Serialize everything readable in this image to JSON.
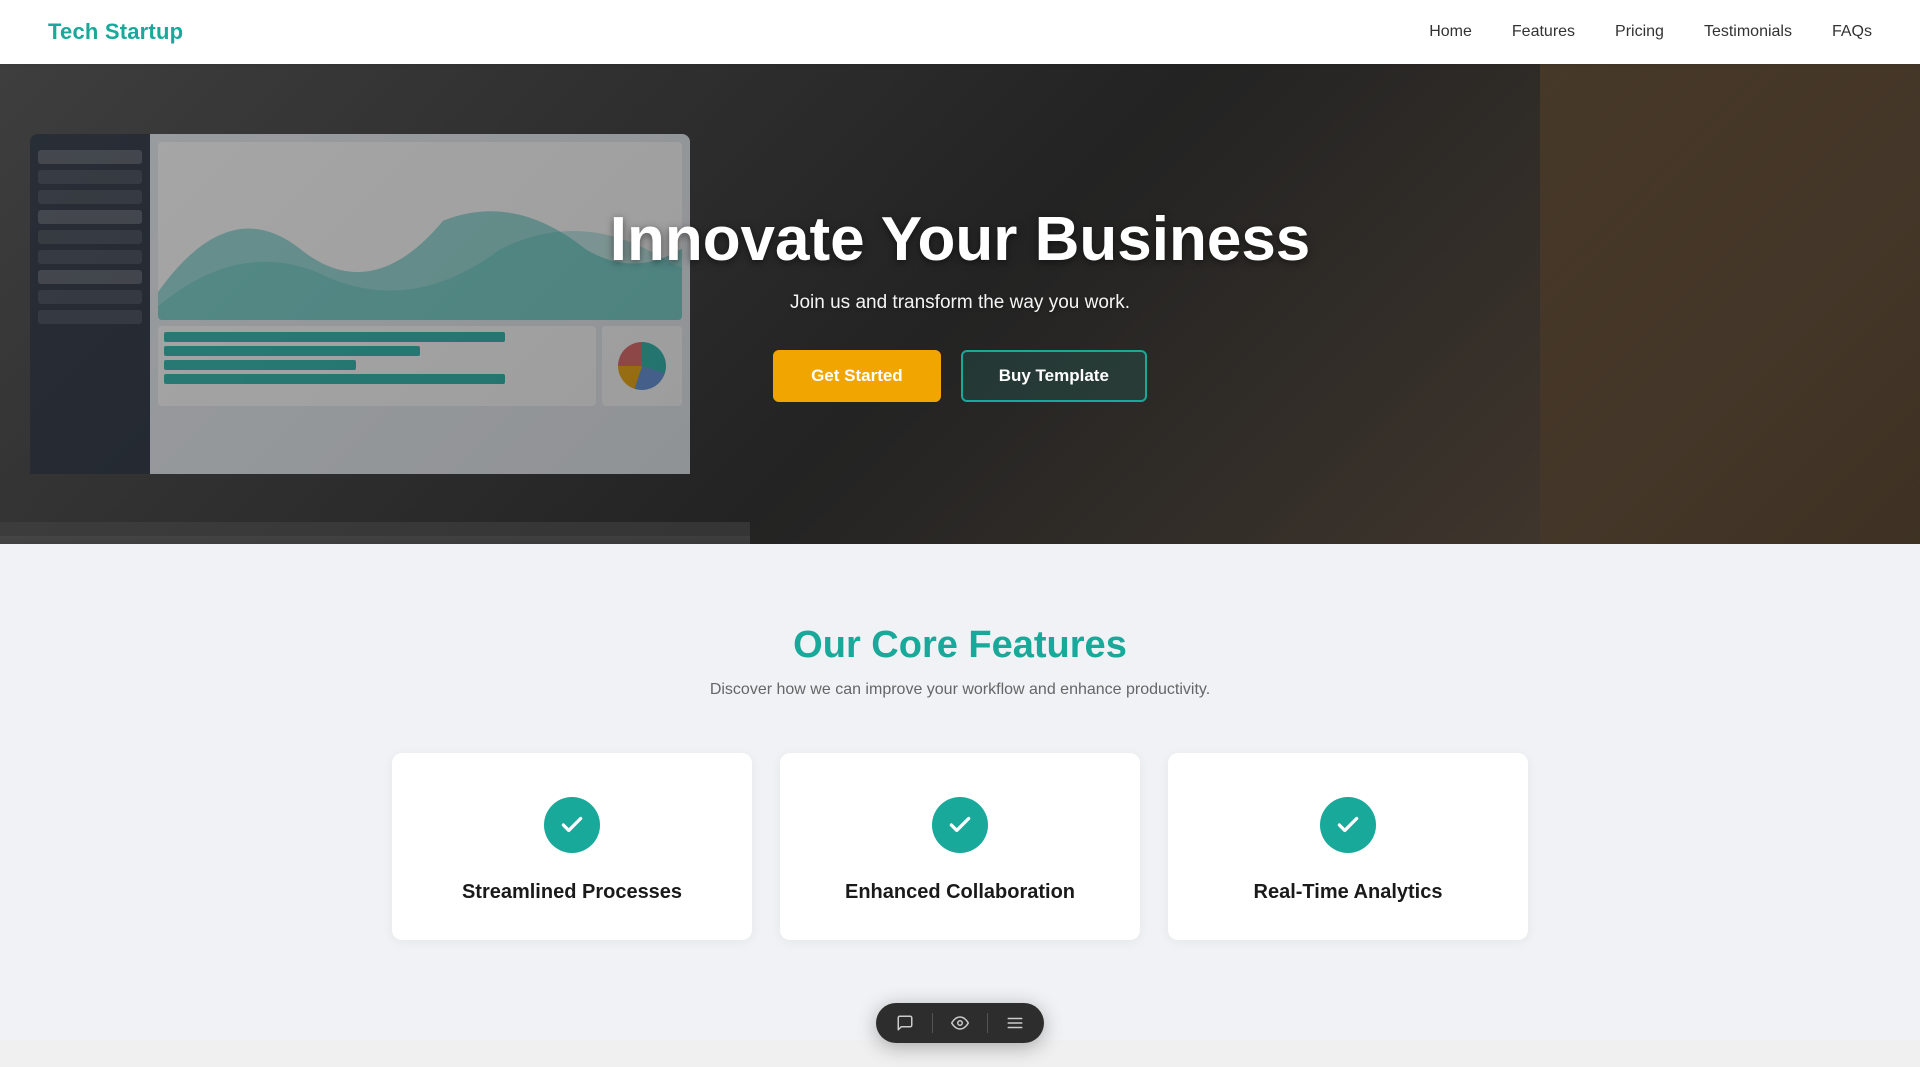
{
  "navbar": {
    "brand": "Tech Startup",
    "links": [
      {
        "label": "Home",
        "id": "home"
      },
      {
        "label": "Features",
        "id": "features"
      },
      {
        "label": "Pricing",
        "id": "pricing"
      },
      {
        "label": "Testimonials",
        "id": "testimonials"
      },
      {
        "label": "FAQs",
        "id": "faqs"
      }
    ]
  },
  "hero": {
    "title": "Innovate Your Business",
    "subtitle": "Join us and transform the way you work.",
    "cta_primary": "Get Started",
    "cta_secondary": "Buy Template"
  },
  "features": {
    "section_title": "Our Core Features",
    "section_subtitle": "Discover how we can improve your workflow and enhance productivity.",
    "cards": [
      {
        "id": "streamlined",
        "title": "Streamlined Processes",
        "icon": "check"
      },
      {
        "id": "collaboration",
        "title": "Enhanced Collaboration",
        "icon": "check"
      },
      {
        "id": "analytics",
        "title": "Real-Time Analytics",
        "icon": "check"
      }
    ]
  },
  "toolbar": {
    "icons": [
      "chat",
      "eye",
      "menu"
    ]
  },
  "colors": {
    "brand": "#18a99a",
    "accent": "#f0a500",
    "dark": "#1a1a1a",
    "light_bg": "#f0f2f5"
  }
}
